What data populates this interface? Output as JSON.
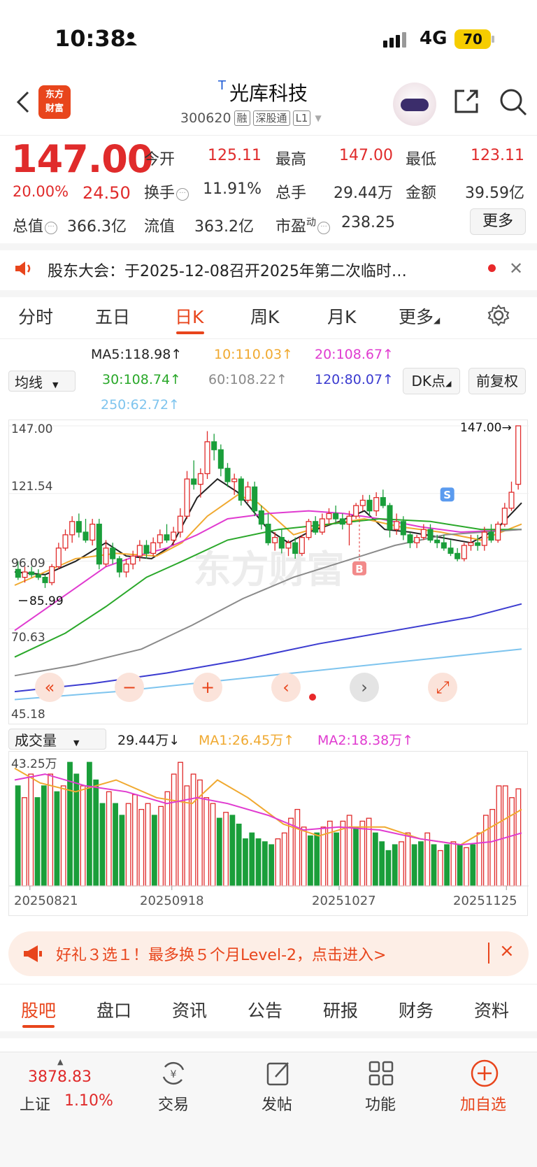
{
  "status_bar": {
    "time": "10:38",
    "network": "4G",
    "battery": "70"
  },
  "header": {
    "logo_line1": "东方",
    "logo_line2": "财富",
    "t_tag": "T",
    "stock_name": "光库科技",
    "code": "300620",
    "tags": [
      "融",
      "深股通",
      "L1"
    ]
  },
  "quote": {
    "price": "147.00",
    "change_pct": "20.00%",
    "change_amt": "24.50",
    "open_label": "今开",
    "open": "125.11",
    "high_label": "最高",
    "high": "147.00",
    "low_label": "最低",
    "low": "123.11",
    "turnover_label": "换手",
    "turnover": "11.91%",
    "volume_label": "总手",
    "volume": "29.44万",
    "amount_label": "金额",
    "amount": "39.59亿",
    "mktcap_label": "总值",
    "mktcap": "366.3亿",
    "float_label": "流值",
    "float_cap": "363.2亿",
    "pe_label": "市盈",
    "pe_sup": "动",
    "pe": "238.25",
    "more_button": "更多"
  },
  "notice": {
    "text": "股东大会：于2025-12-08召开2025年第二次临时…"
  },
  "period_tabs": [
    "分时",
    "五日",
    "日K",
    "周K",
    "月K",
    "更多"
  ],
  "ma_legend": {
    "select": "均线",
    "ma5": "MA5:118.98↑",
    "ma10": "10:110.03↑",
    "ma20": "20:108.67↑",
    "ma30": "30:108.74↑",
    "ma60": "60:108.22↑",
    "ma120": "120:80.07↑",
    "ma250": "250:62.72↑",
    "dk_button": "DK点",
    "fq_button": "前复权",
    "colors": {
      "ma5": "#222222",
      "ma10": "#f0a930",
      "ma20": "#e03bd0",
      "ma30": "#2aa82a",
      "ma60": "#8a8a8a",
      "ma120": "#3b3bd0",
      "ma250": "#7ec4ee"
    }
  },
  "chart_data": {
    "type": "candlestick",
    "y_axis_labels": [
      "147.00",
      "121.54",
      "96.09",
      "70.63",
      "45.18"
    ],
    "ylim": [
      45.18,
      147.0
    ],
    "last_price_label": "147.00→",
    "low_marker_label": "85.99",
    "watermark": "东方财富",
    "signal_markers": [
      "S",
      "B"
    ],
    "candles": [
      [
        93,
        96,
        89,
        90
      ],
      [
        90,
        94,
        88,
        92
      ],
      [
        92,
        94,
        90,
        91
      ],
      [
        91,
        93,
        89,
        90
      ],
      [
        90,
        91,
        86,
        88
      ],
      [
        88,
        95,
        87,
        94
      ],
      [
        94,
        103,
        93,
        101
      ],
      [
        101,
        108,
        100,
        106
      ],
      [
        106,
        113,
        103,
        111
      ],
      [
        111,
        114,
        105,
        107
      ],
      [
        107,
        112,
        103,
        104
      ],
      [
        104,
        112,
        102,
        110
      ],
      [
        110,
        112,
        93,
        95
      ],
      [
        95,
        104,
        94,
        101
      ],
      [
        101,
        103,
        95,
        97
      ],
      [
        97,
        98,
        90,
        92
      ],
      [
        92,
        97,
        90,
        95
      ],
      [
        95,
        100,
        93,
        98
      ],
      [
        98,
        104,
        96,
        102
      ],
      [
        102,
        104,
        97,
        99
      ],
      [
        99,
        105,
        98,
        103
      ],
      [
        103,
        108,
        101,
        106
      ],
      [
        106,
        110,
        103,
        104
      ],
      [
        104,
        109,
        102,
        107
      ],
      [
        107,
        116,
        105,
        113
      ],
      [
        113,
        130,
        112,
        127
      ],
      [
        127,
        134,
        123,
        125
      ],
      [
        125,
        131,
        120,
        129
      ],
      [
        129,
        145,
        127,
        141
      ],
      [
        141,
        144,
        134,
        138
      ],
      [
        138,
        140,
        128,
        131
      ],
      [
        131,
        133,
        124,
        126
      ],
      [
        126,
        129,
        121,
        127
      ],
      [
        127,
        128,
        117,
        119
      ],
      [
        119,
        126,
        118,
        124
      ],
      [
        124,
        126,
        113,
        115
      ],
      [
        115,
        117,
        108,
        110
      ],
      [
        110,
        114,
        102,
        103
      ],
      [
        103,
        107,
        100,
        105
      ],
      [
        105,
        108,
        99,
        101
      ],
      [
        101,
        104,
        98,
        103
      ],
      [
        103,
        105,
        97,
        99
      ],
      [
        99,
        106,
        98,
        105
      ],
      [
        105,
        112,
        104,
        111
      ],
      [
        111,
        113,
        106,
        107
      ],
      [
        107,
        114,
        106,
        112
      ],
      [
        112,
        116,
        110,
        114
      ],
      [
        114,
        117,
        110,
        112
      ],
      [
        112,
        114,
        108,
        110
      ],
      [
        110,
        115,
        102,
        113
      ],
      [
        113,
        118,
        112,
        117
      ],
      [
        117,
        121,
        115,
        119
      ],
      [
        119,
        121,
        113,
        115
      ],
      [
        115,
        122,
        113,
        120
      ],
      [
        120,
        123,
        116,
        117
      ],
      [
        117,
        118,
        105,
        108
      ],
      [
        108,
        114,
        106,
        111
      ],
      [
        111,
        113,
        104,
        106
      ],
      [
        106,
        107,
        101,
        103
      ],
      [
        103,
        106,
        101,
        105
      ],
      [
        105,
        110,
        104,
        108
      ],
      [
        108,
        110,
        103,
        104
      ],
      [
        104,
        106,
        101,
        103
      ],
      [
        103,
        106,
        100,
        101
      ],
      [
        101,
        104,
        98,
        99
      ],
      [
        99,
        101,
        96,
        97
      ],
      [
        97,
        103,
        96,
        102
      ],
      [
        102,
        106,
        100,
        103
      ],
      [
        103,
        106,
        100,
        102
      ],
      [
        102,
        109,
        100,
        107
      ],
      [
        107,
        110,
        103,
        104
      ],
      [
        104,
        111,
        103,
        110
      ],
      [
        110,
        118,
        109,
        116
      ],
      [
        116,
        126,
        115,
        122
      ],
      [
        125,
        147,
        123,
        147
      ]
    ],
    "ma_lines": {
      "ma5": [
        [
          0,
          92
        ],
        [
          0.06,
          91
        ],
        [
          0.12,
          96
        ],
        [
          0.18,
          103
        ],
        [
          0.22,
          98
        ],
        [
          0.27,
          97
        ],
        [
          0.31,
          102
        ],
        [
          0.36,
          120
        ],
        [
          0.4,
          127
        ],
        [
          0.44,
          122
        ],
        [
          0.5,
          108
        ],
        [
          0.54,
          103
        ],
        [
          0.58,
          107
        ],
        [
          0.64,
          111
        ],
        [
          0.69,
          115
        ],
        [
          0.73,
          108
        ],
        [
          0.78,
          107
        ],
        [
          0.84,
          105
        ],
        [
          0.9,
          103
        ],
        [
          0.95,
          108
        ],
        [
          1.0,
          118
        ]
      ],
      "ma10": [
        [
          0,
          87
        ],
        [
          0.06,
          92
        ],
        [
          0.12,
          97
        ],
        [
          0.2,
          99
        ],
        [
          0.28,
          98
        ],
        [
          0.33,
          103
        ],
        [
          0.38,
          113
        ],
        [
          0.44,
          121
        ],
        [
          0.48,
          118
        ],
        [
          0.55,
          106
        ],
        [
          0.62,
          110
        ],
        [
          0.69,
          112
        ],
        [
          0.76,
          109
        ],
        [
          0.84,
          107
        ],
        [
          0.92,
          104
        ],
        [
          1.0,
          110
        ]
      ],
      "ma20": [
        [
          0,
          70
        ],
        [
          0.06,
          78
        ],
        [
          0.12,
          86
        ],
        [
          0.18,
          94
        ],
        [
          0.24,
          98
        ],
        [
          0.3,
          101
        ],
        [
          0.36,
          106
        ],
        [
          0.42,
          112
        ],
        [
          0.5,
          114
        ],
        [
          0.58,
          115
        ],
        [
          0.65,
          114
        ],
        [
          0.72,
          112
        ],
        [
          0.8,
          109
        ],
        [
          0.88,
          107
        ],
        [
          1.0,
          108
        ]
      ],
      "ma30": [
        [
          0,
          60
        ],
        [
          0.1,
          69
        ],
        [
          0.18,
          79
        ],
        [
          0.26,
          90
        ],
        [
          0.33,
          96
        ],
        [
          0.42,
          104
        ],
        [
          0.52,
          108
        ],
        [
          0.62,
          110
        ],
        [
          0.72,
          112
        ],
        [
          0.82,
          111
        ],
        [
          0.92,
          108
        ],
        [
          1.0,
          108
        ]
      ],
      "ma60": [
        [
          0,
          53
        ],
        [
          0.12,
          57
        ],
        [
          0.25,
          63
        ],
        [
          0.35,
          72
        ],
        [
          0.45,
          82
        ],
        [
          0.55,
          90
        ],
        [
          0.65,
          96
        ],
        [
          0.75,
          102
        ],
        [
          0.85,
          106
        ],
        [
          1.0,
          108
        ]
      ],
      "ma120": [
        [
          0,
          47
        ],
        [
          0.15,
          50
        ],
        [
          0.3,
          54
        ],
        [
          0.45,
          59
        ],
        [
          0.6,
          65
        ],
        [
          0.75,
          70
        ],
        [
          0.9,
          75
        ],
        [
          1.0,
          80
        ]
      ],
      "ma250": [
        [
          0,
          44
        ],
        [
          0.2,
          47
        ],
        [
          0.4,
          51
        ],
        [
          0.6,
          55
        ],
        [
          0.8,
          59
        ],
        [
          1.0,
          63
        ]
      ]
    },
    "controls": [
      "«",
      "−",
      "+",
      "‹",
      "›",
      "⤢"
    ]
  },
  "volume": {
    "select": "成交量",
    "current": "29.44万↓",
    "ma1": "MA1:26.45万↑",
    "ma2": "MA2:18.38万↑",
    "max_label": "43.25万",
    "dates": [
      "20250821",
      "20250918",
      "20251027",
      "20251125"
    ],
    "bars": [
      [
        34,
        0
      ],
      [
        30,
        1
      ],
      [
        38,
        1
      ],
      [
        30,
        0
      ],
      [
        34,
        0
      ],
      [
        38,
        1
      ],
      [
        32,
        0
      ],
      [
        34,
        1
      ],
      [
        42,
        0
      ],
      [
        38,
        0
      ],
      [
        34,
        1
      ],
      [
        42,
        0
      ],
      [
        36,
        0
      ],
      [
        28,
        0
      ],
      [
        32,
        1
      ],
      [
        28,
        0
      ],
      [
        24,
        0
      ],
      [
        28,
        1
      ],
      [
        31,
        1
      ],
      [
        26,
        1
      ],
      [
        28,
        1
      ],
      [
        24,
        0
      ],
      [
        27,
        1
      ],
      [
        32,
        1
      ],
      [
        38,
        1
      ],
      [
        42,
        1
      ],
      [
        34,
        1
      ],
      [
        38,
        1
      ],
      [
        36,
        1
      ],
      [
        30,
        1
      ],
      [
        28,
        1
      ],
      [
        23,
        0
      ],
      [
        25,
        1
      ],
      [
        24,
        0
      ],
      [
        21,
        0
      ],
      [
        16,
        0
      ],
      [
        18,
        0
      ],
      [
        16,
        0
      ],
      [
        15,
        0
      ],
      [
        14,
        0
      ],
      [
        16,
        1
      ],
      [
        18,
        1
      ],
      [
        23,
        1
      ],
      [
        26,
        1
      ],
      [
        20,
        1
      ],
      [
        17,
        0
      ],
      [
        18,
        0
      ],
      [
        20,
        1
      ],
      [
        22,
        1
      ],
      [
        18,
        0
      ],
      [
        22,
        1
      ],
      [
        24,
        1
      ],
      [
        20,
        0
      ],
      [
        22,
        1
      ],
      [
        23,
        1
      ],
      [
        18,
        0
      ],
      [
        15,
        0
      ],
      [
        12,
        0
      ],
      [
        14,
        0
      ],
      [
        15,
        1
      ],
      [
        18,
        1
      ],
      [
        14,
        0
      ],
      [
        15,
        0
      ],
      [
        18,
        1
      ],
      [
        14,
        0
      ],
      [
        12,
        1
      ],
      [
        14,
        0
      ],
      [
        15,
        1
      ],
      [
        14,
        0
      ],
      [
        13,
        1
      ],
      [
        14,
        0
      ],
      [
        18,
        1
      ],
      [
        24,
        1
      ],
      [
        26,
        1
      ],
      [
        34,
        1
      ],
      [
        34,
        1
      ],
      [
        30,
        1
      ],
      [
        33,
        1
      ]
    ],
    "ma1_line": [
      [
        0,
        40
      ],
      [
        0.05,
        35
      ],
      [
        0.12,
        32
      ],
      [
        0.2,
        36
      ],
      [
        0.28,
        30
      ],
      [
        0.35,
        28
      ],
      [
        0.4,
        36
      ],
      [
        0.46,
        30
      ],
      [
        0.53,
        21
      ],
      [
        0.6,
        17
      ],
      [
        0.66,
        20
      ],
      [
        0.73,
        20
      ],
      [
        0.8,
        16
      ],
      [
        0.88,
        14
      ],
      [
        0.94,
        20
      ],
      [
        1.0,
        26
      ]
    ],
    "ma2_line": [
      [
        0,
        36
      ],
      [
        0.06,
        38
      ],
      [
        0.14,
        34
      ],
      [
        0.22,
        32
      ],
      [
        0.3,
        28
      ],
      [
        0.36,
        30
      ],
      [
        0.42,
        28
      ],
      [
        0.5,
        24
      ],
      [
        0.57,
        19
      ],
      [
        0.64,
        20
      ],
      [
        0.72,
        19
      ],
      [
        0.8,
        16
      ],
      [
        0.88,
        14
      ],
      [
        0.94,
        15
      ],
      [
        1.0,
        18
      ]
    ]
  },
  "promo": {
    "text": "好礼３选１！最多换５个月Level-2，点击进入>",
    "close": "×"
  },
  "bottom_tabs": [
    "股吧",
    "盘口",
    "资讯",
    "公告",
    "研报",
    "财务",
    "资料"
  ],
  "bottom_nav": {
    "index_value": "3878.83",
    "index_name": "上证",
    "index_pct": "1.10%",
    "trade": "交易",
    "post": "发帖",
    "functions": "功能",
    "add_watch": "加自选"
  }
}
